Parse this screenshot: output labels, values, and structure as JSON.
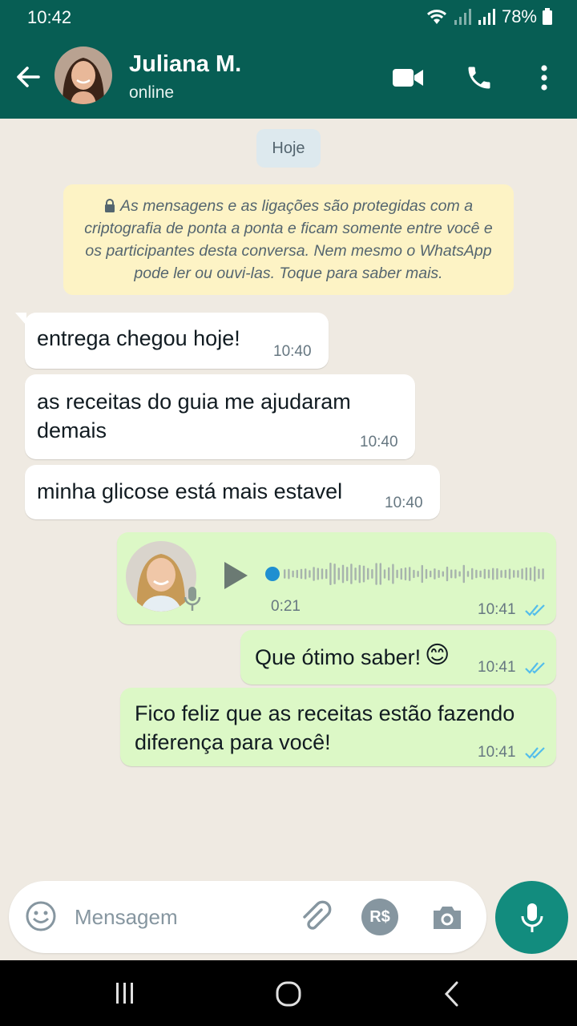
{
  "status_bar": {
    "time": "10:42",
    "battery": "78%"
  },
  "header": {
    "contact_name": "Juliana M.",
    "contact_status": "online"
  },
  "chat": {
    "date_chip": "Hoje",
    "encryption_notice": "As mensagens e as ligações são protegidas com a criptografia de ponta a ponta e ficam somente entre você e os participantes desta conversa. Nem mesmo o WhatsApp pode ler ou ouvi-las. Toque para saber mais.",
    "messages": [
      {
        "direction": "in",
        "text": "entrega chegou hoje!",
        "time": "10:40"
      },
      {
        "direction": "in",
        "text": "as receitas do guia me ajudaram demais",
        "time": "10:40"
      },
      {
        "direction": "in",
        "text": "minha glicose está mais estavel",
        "time": "10:40"
      },
      {
        "direction": "out",
        "type": "voice",
        "duration": "0:21",
        "time": "10:41",
        "status": "read"
      },
      {
        "direction": "out",
        "text": "Que ótimo saber!",
        "emoji": "😊",
        "time": "10:41",
        "status": "read"
      },
      {
        "direction": "out",
        "text": "Fico feliz que as receitas estão fazendo diferença para você!",
        "time": "10:41",
        "status": "read"
      }
    ]
  },
  "composer": {
    "placeholder": "Mensagem",
    "payment_label": "R$"
  },
  "colors": {
    "header": "#075e54",
    "out_bubble": "#dcf8c6",
    "in_bubble": "#ffffff",
    "background": "#efeae2",
    "accent": "#128c7e",
    "read_ticks": "#53bdeb"
  },
  "icons": [
    "back-arrow-icon",
    "video-call-icon",
    "phone-icon",
    "more-vert-icon",
    "lock-icon",
    "play-icon",
    "mic-icon",
    "emoji-icon",
    "attach-icon",
    "payment-icon",
    "camera-icon",
    "recents-icon",
    "home-icon",
    "nav-back-icon",
    "wifi-icon",
    "signal-icon",
    "battery-icon",
    "double-check-icon"
  ]
}
